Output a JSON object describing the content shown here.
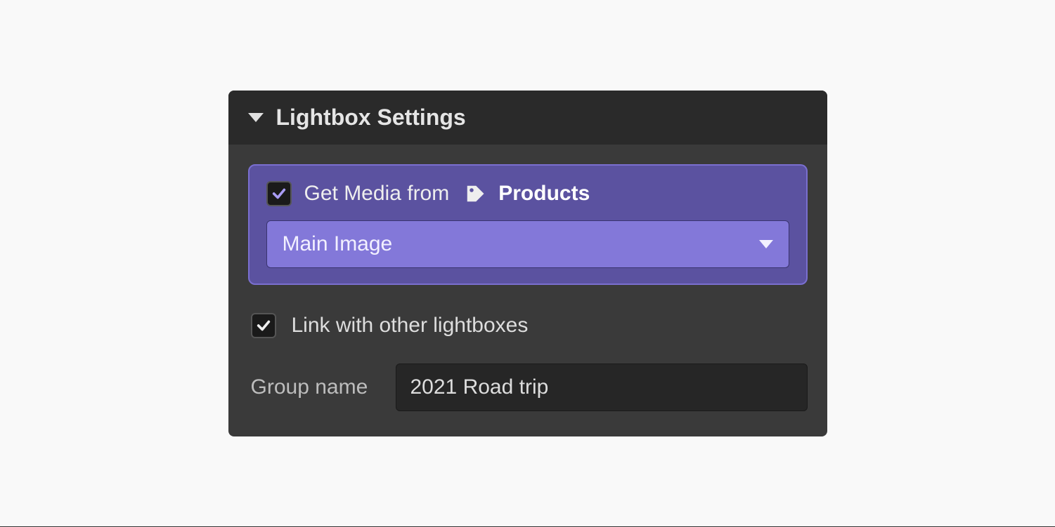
{
  "panel": {
    "title": "Lightbox Settings"
  },
  "media": {
    "checkbox_checked": true,
    "label": "Get Media from",
    "source": "Products",
    "dropdown_value": "Main Image"
  },
  "link": {
    "checkbox_checked": true,
    "label": "Link with other lightboxes"
  },
  "group": {
    "label": "Group name",
    "value": "2021 Road trip"
  },
  "colors": {
    "accent": "#8378d9",
    "checkmark_purple": "#a99cf5",
    "checkmark_white": "#eee"
  }
}
